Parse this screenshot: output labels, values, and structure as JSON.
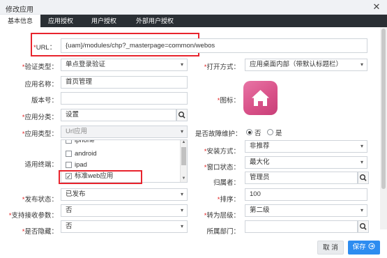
{
  "window": {
    "title": "修改应用",
    "close_glyph": "✕"
  },
  "tabs": [
    {
      "label": "基本信息",
      "active": true
    },
    {
      "label": "应用授权",
      "active": false
    },
    {
      "label": "用户授权",
      "active": false
    },
    {
      "label": "外部用户授权",
      "active": false
    }
  ],
  "form": {
    "url": {
      "label": "URL：",
      "value": "{uam}/modules/chp?_masterpage=common/webos"
    },
    "auth_type": {
      "label": "验证类型：",
      "value": "单点登录验证"
    },
    "open_mode": {
      "label": "打开方式：",
      "value": "应用桌面内部（带默认标题栏）"
    },
    "app_name": {
      "label": "应用名称：",
      "value": "首页管理"
    },
    "version": {
      "label": "版本号：",
      "value": ""
    },
    "icon": {
      "label": "图标：",
      "icon_name": "home-icon",
      "bg_color": "#d95289"
    },
    "category": {
      "label": "应用分类：",
      "value": "设置"
    },
    "app_type": {
      "label": "应用类型：",
      "value": "Url应用"
    },
    "maintenance": {
      "label": "是否故障维护：",
      "options": [
        "否",
        "是"
      ],
      "selected": "否"
    },
    "terminals": {
      "label": "适用终端：",
      "items": [
        {
          "label": "iphone",
          "checked": false
        },
        {
          "label": "android",
          "checked": false
        },
        {
          "label": "ipad",
          "checked": false
        },
        {
          "label": "标准web应用",
          "checked": true
        }
      ]
    },
    "install_mode": {
      "label": "安装方式：",
      "value": "非推荐"
    },
    "window_state": {
      "label": "窗口状态：",
      "value": "最大化"
    },
    "owner": {
      "label": "归属者：",
      "value": "管理员"
    },
    "publish_status": {
      "label": "发布状态：",
      "value": "已发布"
    },
    "sort": {
      "label": "排序：",
      "value": "100"
    },
    "receive_params": {
      "label": "支持接收参数：",
      "value": "否"
    },
    "layer": {
      "label": "转为层级：",
      "value": "第二级"
    },
    "hidden": {
      "label": "是否隐藏：",
      "value": "否"
    },
    "department": {
      "label": "所属部门：",
      "value": ""
    }
  },
  "footer": {
    "cancel_label": "取 消",
    "save_label": "保存"
  },
  "colors": {
    "accent": "#2d8cf0",
    "tabbar": "#2a2f34",
    "highlight": "#e8242d",
    "required": "#e02020"
  }
}
